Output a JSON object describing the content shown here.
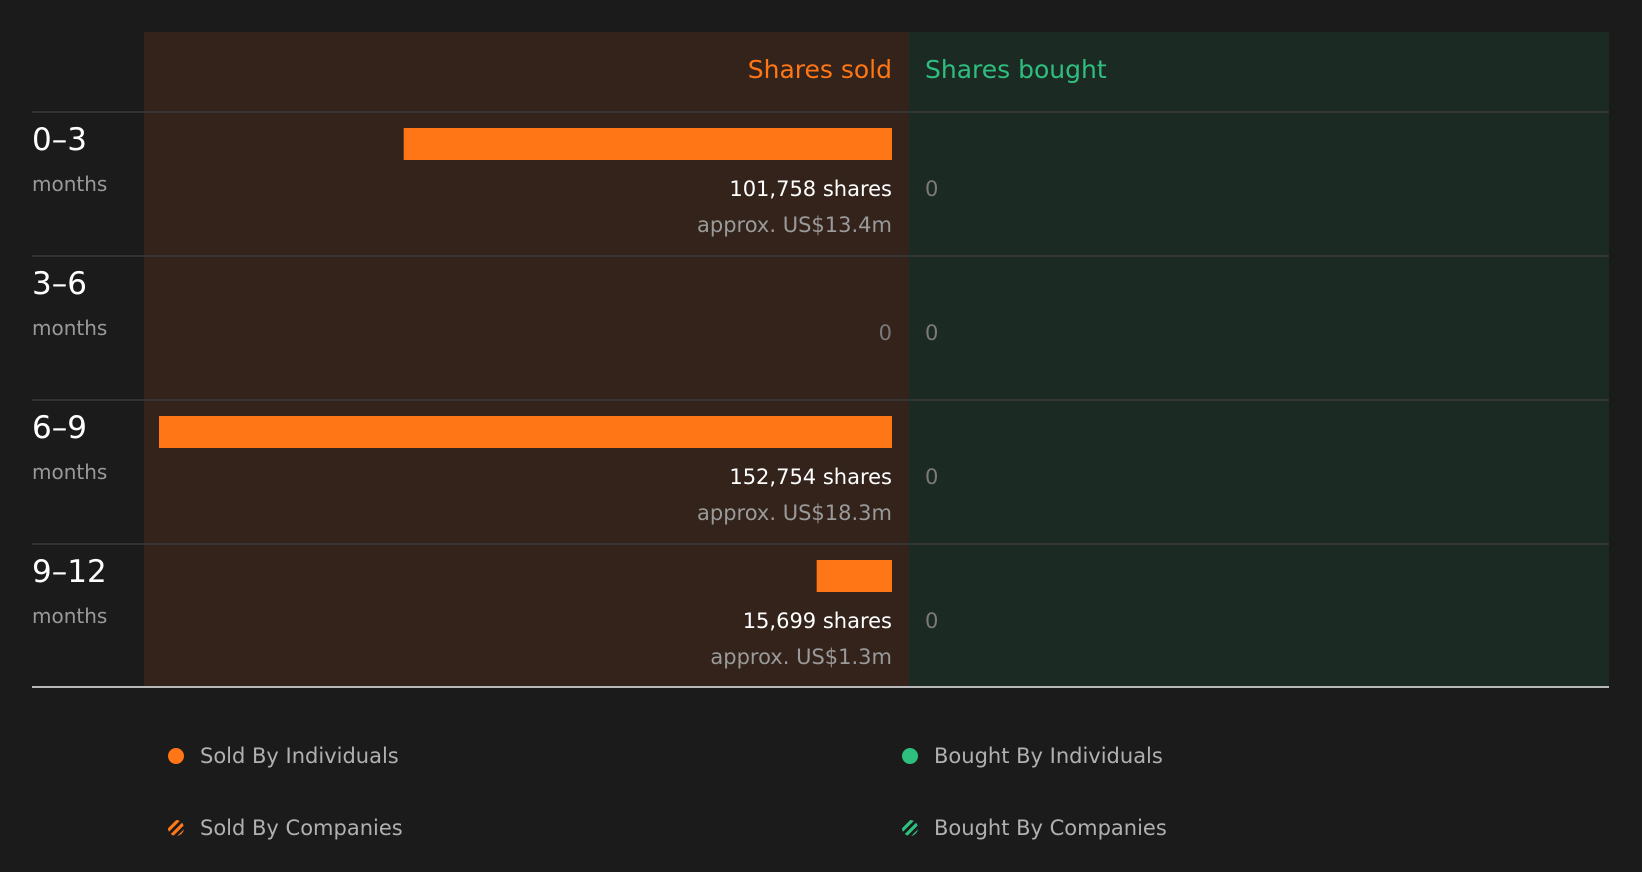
{
  "colors": {
    "background": "#1b1b1b",
    "sold_panel": "#33231b",
    "bought_panel": "#1c2a24",
    "sold": "#ff7616",
    "bought": "#2ebf7f",
    "text_primary": "#ffffff",
    "text_muted": "#9a9a9a",
    "zero": "#7a7a7a"
  },
  "chart_data": {
    "type": "bar",
    "orientation": "horizontal-diverging",
    "columns": {
      "sold": "Shares sold",
      "bought": "Shares bought"
    },
    "categories": [
      {
        "range": "0–3",
        "unit": "months"
      },
      {
        "range": "3–6",
        "unit": "months"
      },
      {
        "range": "6–9",
        "unit": "months"
      },
      {
        "range": "9–12",
        "unit": "months"
      }
    ],
    "series": [
      {
        "name": "Shares sold",
        "values": [
          101758,
          0,
          152754,
          15699
        ],
        "labels": [
          "101,758 shares",
          "0",
          "152,754 shares",
          "15,699 shares"
        ],
        "approx": [
          "approx. US$13.4m",
          "",
          "approx. US$18.3m",
          "approx. US$1.3m"
        ]
      },
      {
        "name": "Shares bought",
        "values": [
          0,
          0,
          0,
          0
        ],
        "labels": [
          "0",
          "0",
          "0",
          "0"
        ],
        "approx": [
          "",
          "",
          "",
          ""
        ]
      }
    ],
    "xlim": [
      0,
      152754
    ],
    "legend": [
      {
        "label": "Sold By Individuals",
        "marker": "solid-dot",
        "color": "#ff7616"
      },
      {
        "label": "Bought By Individuals",
        "marker": "solid-dot",
        "color": "#2ebf7f"
      },
      {
        "label": "Sold By Companies",
        "marker": "hatched-dot",
        "color": "#ff7616"
      },
      {
        "label": "Bought By Companies",
        "marker": "hatched-dot",
        "color": "#2ebf7f"
      }
    ],
    "legend_position": "bottom"
  }
}
